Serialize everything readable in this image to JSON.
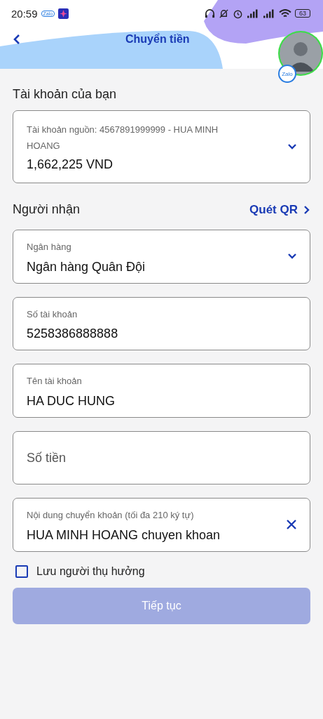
{
  "status_bar": {
    "time": "20:59",
    "app_badge": "Zalo",
    "battery": "63"
  },
  "header": {
    "title": "Chuyển tiền",
    "avatar_badge": "Zalo"
  },
  "source": {
    "heading": "Tài khoản của bạn",
    "label": "Tài khoản nguồn: 4567891999999 - HUA MINH HOANG",
    "balance": "1,662,225 VND"
  },
  "recipient": {
    "heading": "Người nhận",
    "qr_link": "Quét QR"
  },
  "fields": [
    {
      "kind": "select",
      "label": "Ngân hàng",
      "value": "Ngân hàng Quân Đội"
    },
    {
      "kind": "text",
      "label": "Số tài khoản",
      "value": "5258386888888"
    },
    {
      "kind": "text",
      "label": "Tên tài khoản",
      "value": "HA DUC HUNG"
    },
    {
      "kind": "empty",
      "placeholder": "Số tiền"
    },
    {
      "kind": "clearable",
      "label": "Nội dung chuyển khoản (tối đa 210 ký tự)",
      "value": "HUA MINH HOANG chuyen khoan"
    }
  ],
  "save_beneficiary": {
    "label": "Lưu người thụ hưởng",
    "checked": false
  },
  "continue_button": {
    "label": "Tiếp tục",
    "disabled": true
  }
}
